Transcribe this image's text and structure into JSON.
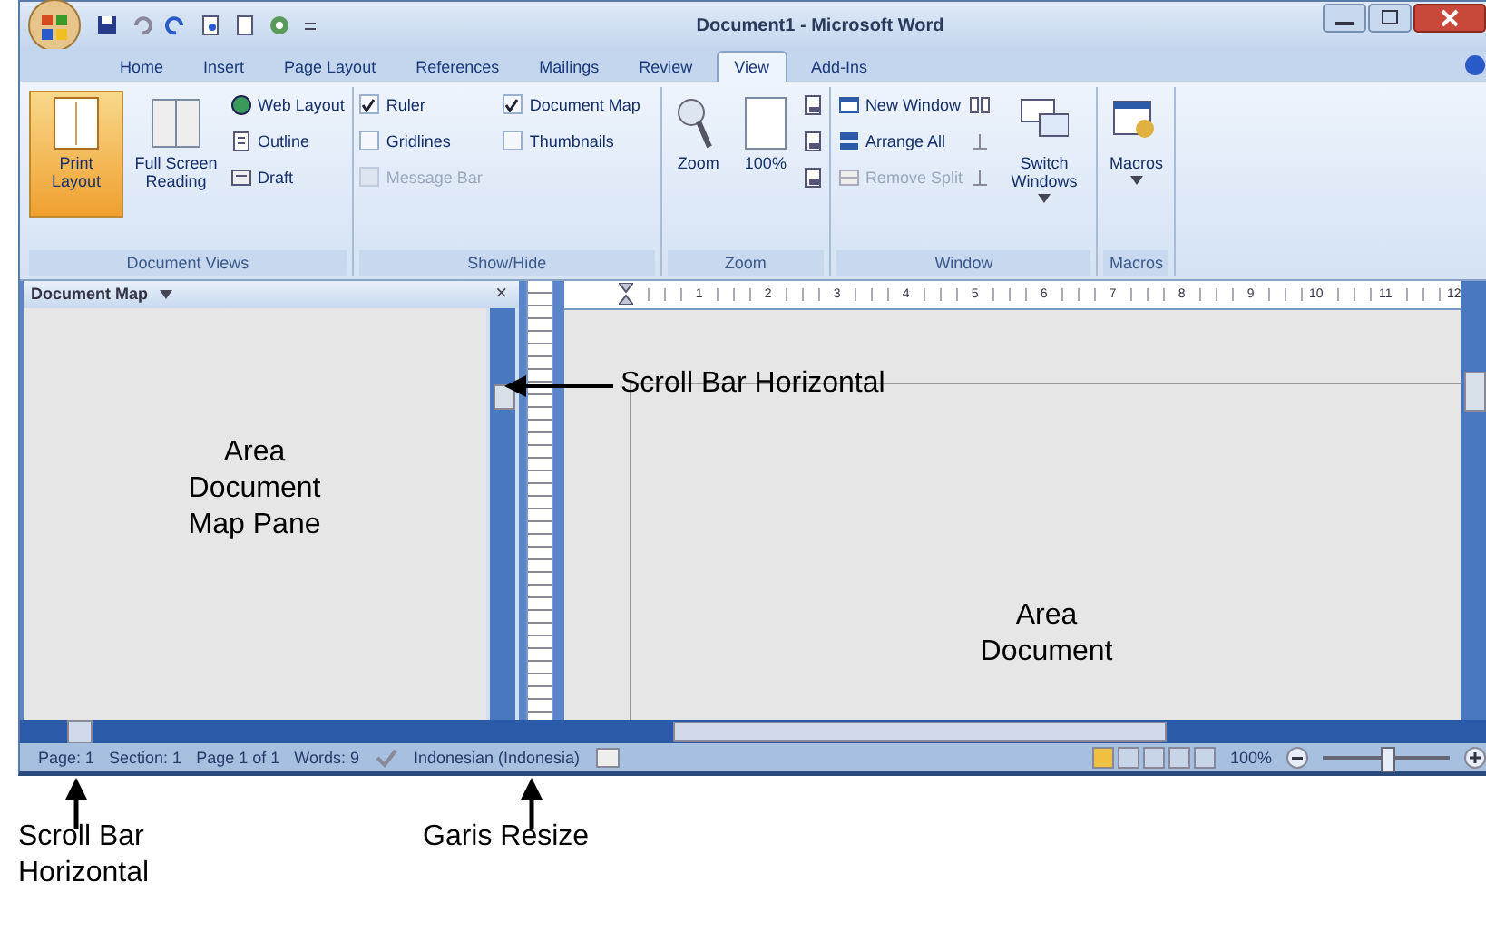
{
  "window": {
    "title": "Document1 - Microsoft Word"
  },
  "tabs": [
    {
      "label": "Home",
      "selected": false
    },
    {
      "label": "Insert",
      "selected": false
    },
    {
      "label": "Page Layout",
      "selected": false
    },
    {
      "label": "References",
      "selected": false
    },
    {
      "label": "Mailings",
      "selected": false
    },
    {
      "label": "Review",
      "selected": false
    },
    {
      "label": "View",
      "selected": true
    },
    {
      "label": "Add-Ins",
      "selected": false
    }
  ],
  "ribbon": {
    "groups": [
      {
        "label": "Document Views",
        "columns": [
          [
            {
              "kind": "large",
              "label": "Print Layout",
              "selected": true
            }
          ],
          [
            {
              "kind": "large",
              "label": "Full Screen Reading",
              "selected": false
            }
          ],
          [
            {
              "kind": "small",
              "label": "Web Layout",
              "disabled": false
            },
            {
              "kind": "small",
              "label": "Outline",
              "disabled": false
            },
            {
              "kind": "small",
              "label": "Draft",
              "disabled": false
            }
          ]
        ]
      },
      {
        "label": "Show/Hide",
        "columns": [
          [
            {
              "kind": "check",
              "label": "Ruler",
              "checked": true,
              "disabled": false
            },
            {
              "kind": "check",
              "label": "Gridlines",
              "checked": false,
              "disabled": false
            },
            {
              "kind": "check",
              "label": "Message Bar",
              "checked": false,
              "disabled": true
            }
          ],
          [
            {
              "kind": "check",
              "label": "Document Map",
              "checked": true,
              "disabled": false
            },
            {
              "kind": "check",
              "label": "Thumbnails",
              "checked": false,
              "disabled": false
            }
          ]
        ]
      },
      {
        "label": "Zoom",
        "columns": [
          [
            {
              "kind": "large",
              "label": "Zoom",
              "selected": false
            }
          ],
          [
            {
              "kind": "large",
              "label": "100%",
              "selected": false
            }
          ],
          [
            {
              "kind": "icon"
            },
            {
              "kind": "icon"
            },
            {
              "kind": "icon"
            }
          ]
        ]
      },
      {
        "label": "Window",
        "columns": [
          [
            {
              "kind": "small",
              "label": "New Window",
              "disabled": false
            },
            {
              "kind": "small",
              "label": "Arrange All",
              "disabled": false
            },
            {
              "kind": "small",
              "label": "Remove Split",
              "disabled": true
            }
          ],
          [
            {
              "kind": "icon"
            },
            {
              "kind": "icon"
            },
            {
              "kind": "icon"
            }
          ],
          [
            {
              "kind": "large",
              "label": "Switch Windows",
              "selected": false,
              "dropdown": true
            }
          ]
        ]
      },
      {
        "label": "Macros",
        "columns": [
          [
            {
              "kind": "large",
              "label": "Macros",
              "selected": false,
              "dropdown": true
            }
          ]
        ]
      }
    ]
  },
  "document_map": {
    "title": "Document Map",
    "close": "×"
  },
  "ruler": {
    "labels": [
      "1",
      "2",
      "3",
      "4",
      "5",
      "6",
      "7",
      "8",
      "9",
      "10",
      "11",
      "12"
    ]
  },
  "status_bar": {
    "items": [
      "Page: 1",
      "Section: 1",
      "Page 1 of 1",
      "Words: 9"
    ],
    "language": "Indonesian (Indonesia)",
    "zoom": "100%",
    "level": 0.5
  },
  "annotations": {
    "map_area": "Area Document Map Pane",
    "document_area": "Area Document",
    "callouts": [
      {
        "kind": "right",
        "text": "Scroll Bar Horizontal"
      },
      {
        "kind": "bottom-left",
        "text": "Scroll Bar Horizontal"
      },
      {
        "kind": "bottom-mid",
        "text": "Garis Resize"
      }
    ]
  }
}
